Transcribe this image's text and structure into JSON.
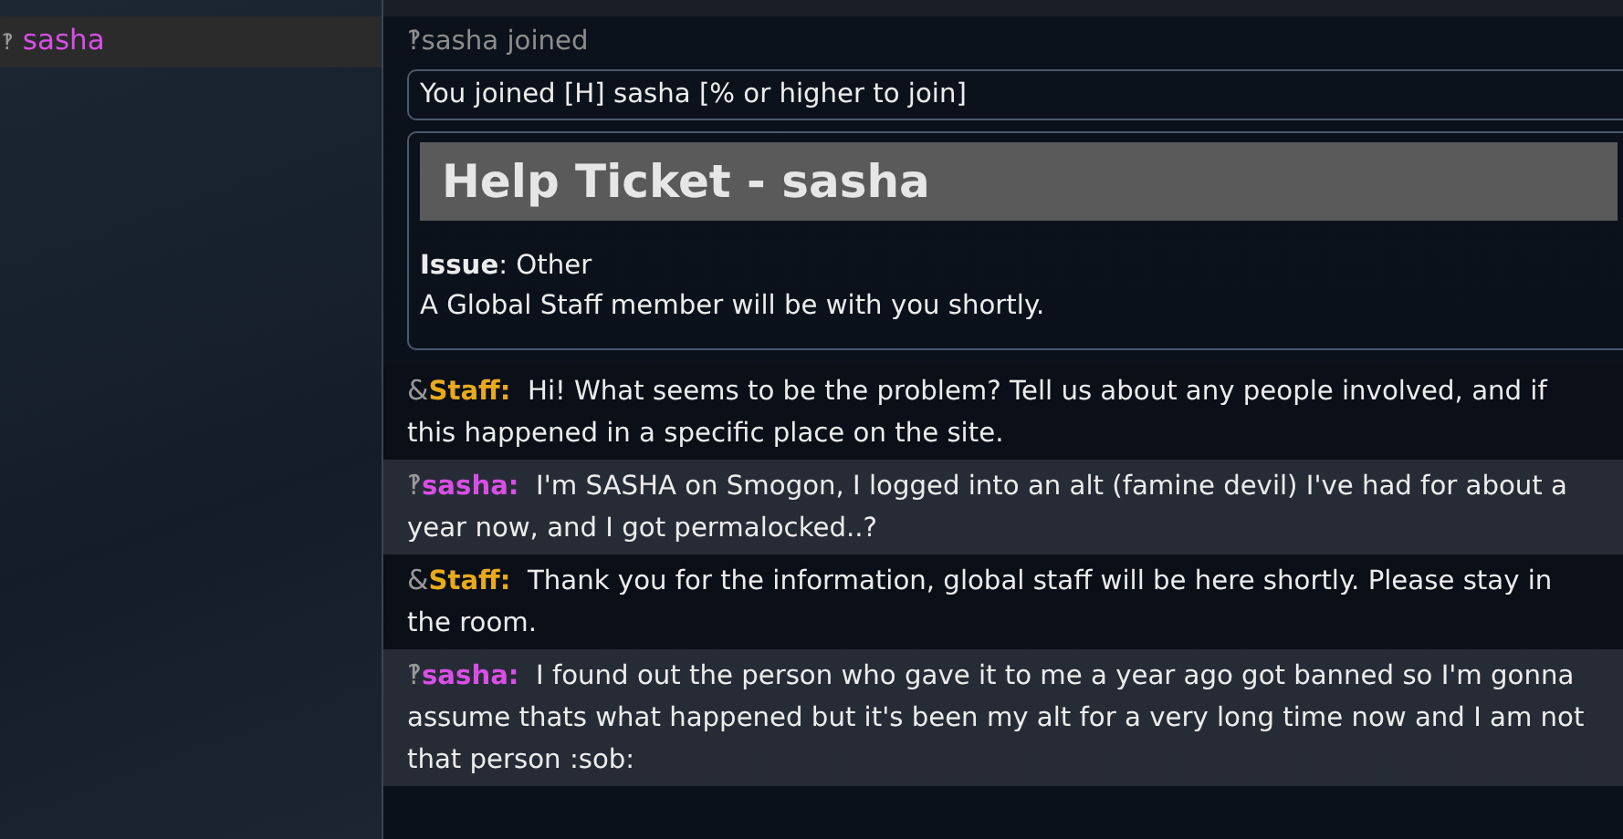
{
  "userlist": [
    {
      "rank": "‽",
      "name": "sasha",
      "color": "#d94fe6",
      "selected": true
    }
  ],
  "chat": {
    "join_notice": {
      "rank": "‽",
      "text": "sasha joined"
    },
    "info_box": "You joined [H] sasha [% or higher to join]",
    "ticket": {
      "title": "Help Ticket - sasha",
      "issue_label": "Issue",
      "issue_value": ": Other",
      "note": "A Global Staff member will be with you shortly."
    },
    "messages": [
      {
        "rank": "&",
        "name": "Staff:",
        "color": "#e8a91c",
        "text": "Hi! What seems to be the problem? Tell us about any people involved, and if this happened in a specific place on the site."
      },
      {
        "rank": "‽",
        "name": "sasha:",
        "color": "#d94fe6",
        "text": "I'm SASHA on Smogon, I logged into an alt (famine devil) I've had for about a year now, and I got permalocked..?"
      },
      {
        "rank": "&",
        "name": "Staff:",
        "color": "#e8a91c",
        "text": "Thank you for the information, global staff will be here shortly. Please stay in the room."
      },
      {
        "rank": "‽",
        "name": "sasha:",
        "color": "#d94fe6",
        "text": "I found out the person who gave it to me a year ago got banned so I'm gonna assume thats what happened but it's been my alt for a very long time now and I am not that person :sob:"
      }
    ]
  }
}
